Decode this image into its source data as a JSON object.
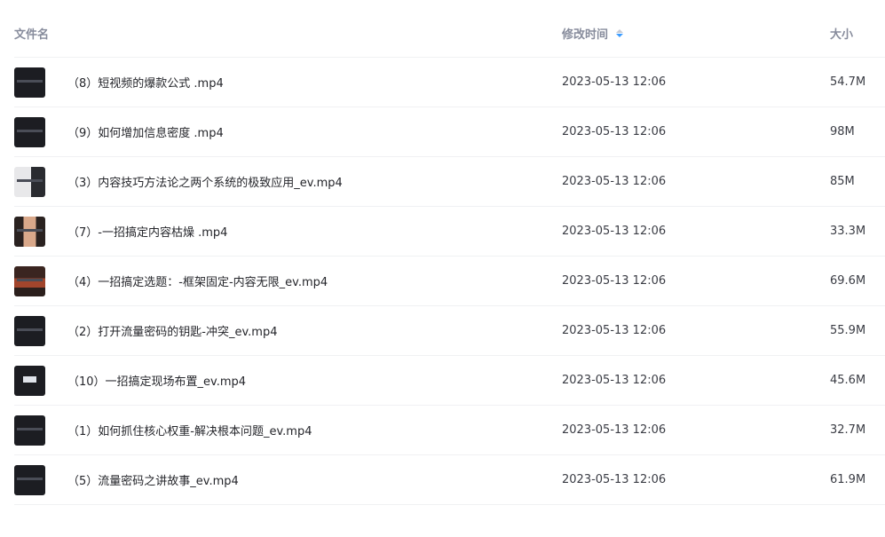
{
  "header": {
    "name": "文件名",
    "time": "修改时间",
    "size": "大小"
  },
  "files": [
    {
      "name": "（8）短视频的爆款公式 .mp4",
      "time": "2023-05-13 12:06",
      "size": "54.7M",
      "thumb": "dark"
    },
    {
      "name": "（9）如何增加信息密度 .mp4",
      "time": "2023-05-13 12:06",
      "size": "98M",
      "thumb": "dark"
    },
    {
      "name": "（3）内容技巧方法论之两个系统的极致应用_ev.mp4",
      "time": "2023-05-13 12:06",
      "size": "85M",
      "thumb": "light"
    },
    {
      "name": "（7）-一招搞定内容枯燥 .mp4",
      "time": "2023-05-13 12:06",
      "size": "33.3M",
      "thumb": "warm"
    },
    {
      "name": "（4）一招搞定选题：-框架固定-内容无限_ev.mp4",
      "time": "2023-05-13 12:06",
      "size": "69.6M",
      "thumb": "red"
    },
    {
      "name": "（2）打开流量密码的钥匙-冲突_ev.mp4",
      "time": "2023-05-13 12:06",
      "size": "55.9M",
      "thumb": "dark"
    },
    {
      "name": "（10）一招搞定现场布置_ev.mp4",
      "time": "2023-05-13 12:06",
      "size": "45.6M",
      "thumb": "screen"
    },
    {
      "name": "（1）如何抓住核心权重-解决根本问题_ev.mp4",
      "time": "2023-05-13 12:06",
      "size": "32.7M",
      "thumb": "dark"
    },
    {
      "name": "（5）流量密码之讲故事_ev.mp4",
      "time": "2023-05-13 12:06",
      "size": "61.9M",
      "thumb": "dark"
    }
  ]
}
